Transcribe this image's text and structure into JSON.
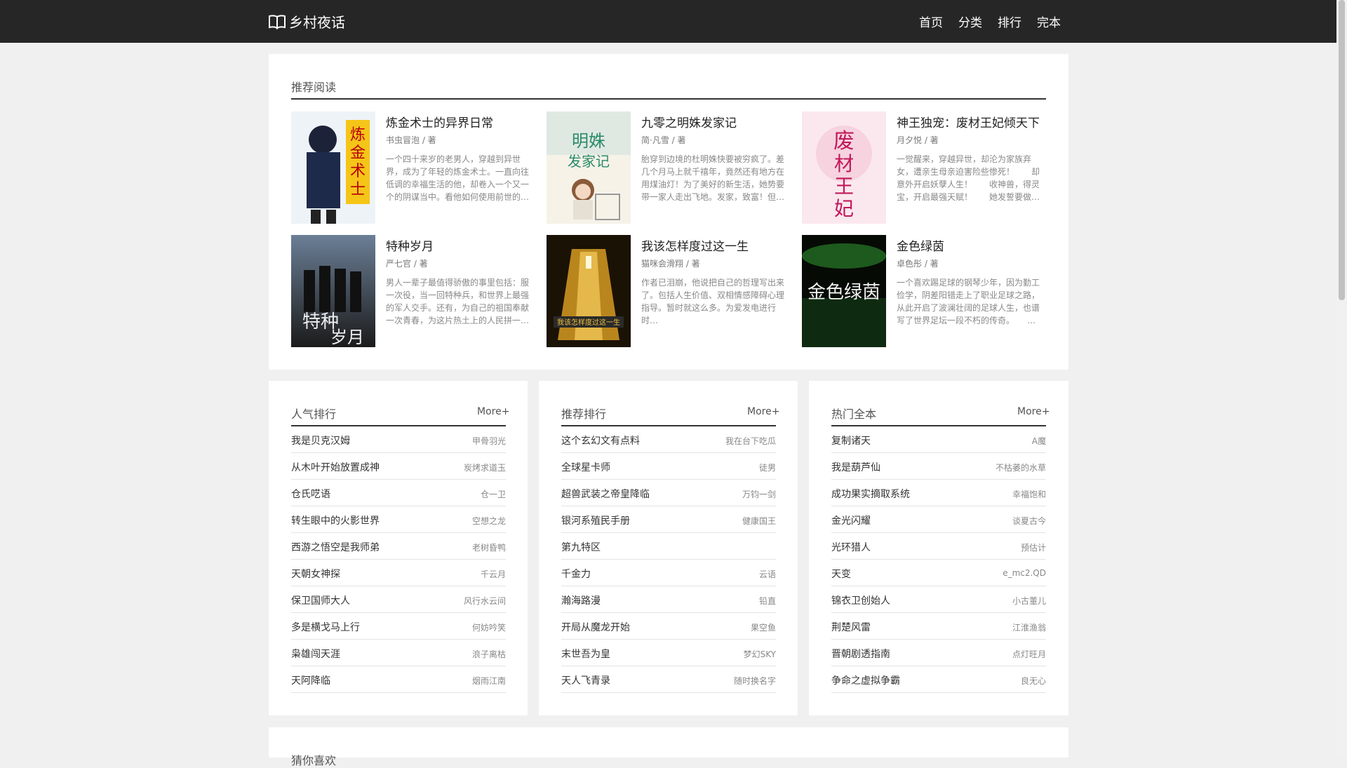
{
  "header": {
    "site_name": "乡村夜话",
    "nav": [
      "首页",
      "分类",
      "排行",
      "完本"
    ]
  },
  "recommend": {
    "title": "推荐阅读",
    "books": [
      {
        "title": "炼金术士的异界日常",
        "author": "书虫冒泡 / 著",
        "desc": "一个四十来岁的老男人，穿越到异世界，成为了年轻的炼金术士。一直向往低调的幸福生活的他，却卷入一个又一个的阴谋当中。看他如何使用前世的…",
        "cover_text": "炼金术士"
      },
      {
        "title": "九零之明姝发家记",
        "author": "简·凡雪 / 著",
        "desc": "胎穿到边境的杜明姝快要被穷疯了。差几个月马上就千禧年，竟然还有地方在用煤油灯！为了美好的新生活，她势要带一家人走出飞地。发家，致富！但…",
        "cover_text": "明姝发家记"
      },
      {
        "title": "神王独宠：废材王妃倾天下",
        "author": "月夕悦 / 著",
        "desc": "一觉醒来，穿越异世，却沦为家族弃女，遭亲生母亲迫害险些惨死！　　却意外开启妖孽人生！　　收神兽，得灵宝，开启最强天赋！　　她发誓要做…",
        "cover_text": "废材王妃"
      },
      {
        "title": "特种岁月",
        "author": "严七官 / 著",
        "desc": "男人一辈子最值得骄傲的事里包括：服一次役，当一回特种兵，和世界上最强的军人交手。还有，为自己的祖国奉献一次青春，为这片热土上的人民拼一…",
        "cover_text": "特种岁月"
      },
      {
        "title": "我该怎样度过这一生",
        "author": "猫咪会滑翔 / 著",
        "desc": "作者已泪崩，他说把自己的哲理写出来了。包括人生价值、双相情感障碍心理指导。暂时就这么多。为爱发电进行时…",
        "cover_text": "我该怎样度过这一生"
      },
      {
        "title": "金色绿茵",
        "author": "卓色彤 / 著",
        "desc": "一个喜欢踢足球的钢琴少年，因为勤工俭学，阴差阳错走上了职业足球之路，从此开启了波澜壮阔的足球人生，也谱写了世界足坛一段不朽的传奇。　　…",
        "cover_text": "金色绿茵"
      }
    ]
  },
  "rankings": [
    {
      "title": "人气排行",
      "more": "More+",
      "items": [
        {
          "name": "我是贝克汉姆",
          "author": "甲骨羽光"
        },
        {
          "name": "从木叶开始放置成神",
          "author": "炭烤求道玉"
        },
        {
          "name": "仓氏呓语",
          "author": "仓一卫"
        },
        {
          "name": "转生眼中的火影世界",
          "author": "空想之龙"
        },
        {
          "name": "西游之悟空是我师弟",
          "author": "老树昏鸭"
        },
        {
          "name": "天朝女神探",
          "author": "千云月"
        },
        {
          "name": "保卫国师大人",
          "author": "风行水云间"
        },
        {
          "name": "多是横戈马上行",
          "author": "何妨吟笑"
        },
        {
          "name": "枭雄闯天涯",
          "author": "浪子离枯"
        },
        {
          "name": "天阿降临",
          "author": "烟雨江南"
        }
      ]
    },
    {
      "title": "推荐排行",
      "more": "More+",
      "items": [
        {
          "name": "这个玄幻文有点料",
          "author": "我在台下吃瓜"
        },
        {
          "name": "全球星卡师",
          "author": "徒男"
        },
        {
          "name": "超兽武装之帝皇降临",
          "author": "万钧一剑"
        },
        {
          "name": "银河系殖民手册",
          "author": "健康国王"
        },
        {
          "name": "第九特区",
          "author": ""
        },
        {
          "name": "千金力",
          "author": "云语"
        },
        {
          "name": "瀚海路漫",
          "author": "铅直"
        },
        {
          "name": "开局从魔龙开始",
          "author": "果空鱼"
        },
        {
          "name": "末世吾为皇",
          "author": "梦幻SKY"
        },
        {
          "name": "天人飞青录",
          "author": "随时换名字"
        }
      ]
    },
    {
      "title": "热门全本",
      "more": "More+",
      "items": [
        {
          "name": "复制诸天",
          "author": "A魔"
        },
        {
          "name": "我是葫芦仙",
          "author": "不枯萎的水草"
        },
        {
          "name": "成功果实摘取系统",
          "author": "幸福饱和"
        },
        {
          "name": "金光闪耀",
          "author": "谈夏古今"
        },
        {
          "name": "光环猎人",
          "author": "预估计"
        },
        {
          "name": "天变",
          "author": "e_mc2.QD"
        },
        {
          "name": "锦衣卫创始人",
          "author": "小古董儿"
        },
        {
          "name": "荆楚风雷",
          "author": "江淮渔翁"
        },
        {
          "name": "晋朝剧透指南",
          "author": "点灯旺月"
        },
        {
          "name": "争命之虚拟争霸",
          "author": "良无心"
        }
      ]
    }
  ],
  "guess": {
    "title": "猜你喜欢"
  }
}
